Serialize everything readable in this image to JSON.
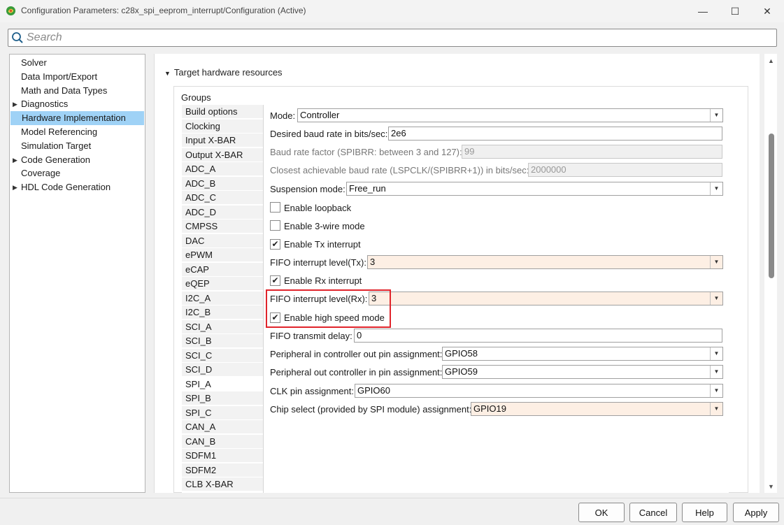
{
  "window": {
    "title": "Configuration Parameters: c28x_spi_eeprom_interrupt/Configuration (Active)",
    "minimize": "—",
    "maximize": "☐",
    "close": "✕"
  },
  "search": {
    "placeholder": "Search"
  },
  "tree": [
    {
      "label": "Solver",
      "expandable": false,
      "selected": false
    },
    {
      "label": "Data Import/Export",
      "expandable": false,
      "selected": false
    },
    {
      "label": "Math and Data Types",
      "expandable": false,
      "selected": false
    },
    {
      "label": "Diagnostics",
      "expandable": true,
      "selected": false
    },
    {
      "label": "Hardware Implementation",
      "expandable": false,
      "selected": true
    },
    {
      "label": "Model Referencing",
      "expandable": false,
      "selected": false
    },
    {
      "label": "Simulation Target",
      "expandable": false,
      "selected": false
    },
    {
      "label": "Code Generation",
      "expandable": true,
      "selected": false
    },
    {
      "label": "Coverage",
      "expandable": false,
      "selected": false
    },
    {
      "label": "HDL Code Generation",
      "expandable": true,
      "selected": false
    }
  ],
  "section": {
    "title": "Target hardware resources",
    "groups_label": "Groups"
  },
  "groups": [
    "Build options",
    "Clocking",
    "Input X-BAR",
    "Output X-BAR",
    "ADC_A",
    "ADC_B",
    "ADC_C",
    "ADC_D",
    "CMPSS",
    "DAC",
    "ePWM",
    "eCAP",
    "eQEP",
    "I2C_A",
    "I2C_B",
    "SCI_A",
    "SCI_B",
    "SCI_C",
    "SCI_D",
    "SPI_A",
    "SPI_B",
    "SPI_C",
    "CAN_A",
    "CAN_B",
    "SDFM1",
    "SDFM2",
    "CLB X-BAR"
  ],
  "selected_group": "SPI_A",
  "form": {
    "mode": {
      "label": "Mode:",
      "value": "Controller"
    },
    "baud": {
      "label": "Desired baud rate in bits/sec:",
      "value": "2e6"
    },
    "baud_factor": {
      "label": "Baud rate factor (SPIBRR: between 3 and 127):",
      "value": "99"
    },
    "closest_baud": {
      "label": "Closest achievable baud rate (LSPCLK/(SPIBRR+1)) in bits/sec:",
      "value": "2000000"
    },
    "suspension": {
      "label": "Suspension mode:",
      "value": "Free_run"
    },
    "loopback": {
      "label": "Enable loopback",
      "checked": false
    },
    "three_wire": {
      "label": "Enable 3-wire mode",
      "checked": false
    },
    "tx_interrupt": {
      "label": "Enable Tx interrupt",
      "checked": true
    },
    "fifo_tx": {
      "label": "FIFO interrupt level(Tx):",
      "value": "3"
    },
    "rx_interrupt": {
      "label": "Enable Rx interrupt",
      "checked": true
    },
    "fifo_rx": {
      "label": "FIFO interrupt level(Rx):",
      "value": "3"
    },
    "high_speed": {
      "label": "Enable high speed mode",
      "checked": true
    },
    "fifo_delay": {
      "label": "FIFO transmit delay:",
      "value": "0"
    },
    "pico": {
      "label": "Peripheral in controller out pin assignment:",
      "value": "GPIO58"
    },
    "poci": {
      "label": "Peripheral out controller in pin assignment:",
      "value": "GPIO59"
    },
    "clk": {
      "label": "CLK pin assignment:",
      "value": "GPIO60"
    },
    "cs": {
      "label": "Chip select (provided by SPI module) assignment:",
      "value": "GPIO19"
    }
  },
  "buttons": {
    "ok": "OK",
    "cancel": "Cancel",
    "help": "Help",
    "apply": "Apply"
  },
  "icons": {
    "check": "✔",
    "dropdown": "▼",
    "expand": "▶",
    "collapse": "▼",
    "scroll_up": "▲",
    "scroll_down": "▼"
  },
  "colors": {
    "selection": "#9fd2f6",
    "highlight_box": "#e0242b",
    "tinted_field": "#fdefe4"
  }
}
